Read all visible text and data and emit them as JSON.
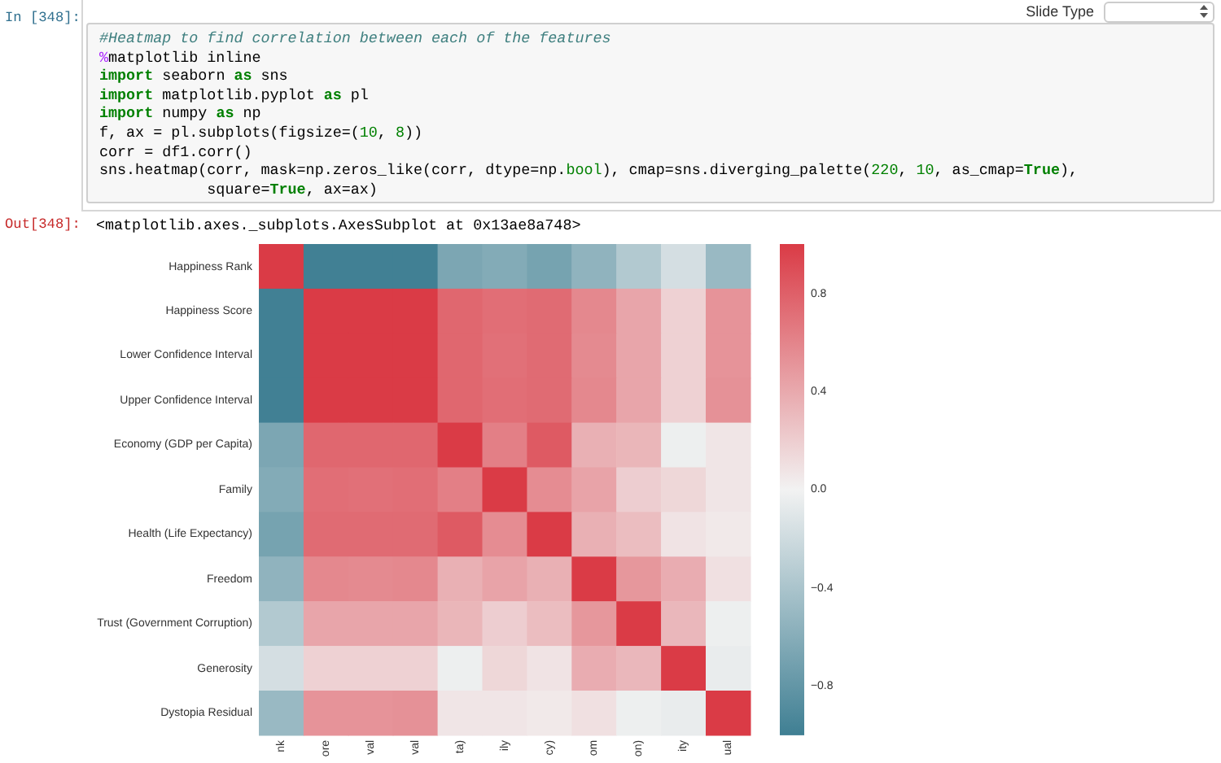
{
  "cell": {
    "prompt": "In [348]:",
    "toolbar": {
      "label": "Slide Type"
    },
    "code_lines": [
      [
        {
          "kind": "comment",
          "text": "#Heatmap to find correlation between each of the features"
        }
      ],
      [
        {
          "kind": "magic",
          "text": "%"
        },
        {
          "kind": "plain",
          "text": "matplotlib inline"
        }
      ],
      [
        {
          "kind": "keyword",
          "text": "import"
        },
        {
          "kind": "plain",
          "text": " seaborn "
        },
        {
          "kind": "keyword",
          "text": "as"
        },
        {
          "kind": "plain",
          "text": " sns"
        }
      ],
      [
        {
          "kind": "keyword",
          "text": "import"
        },
        {
          "kind": "plain",
          "text": " matplotlib.pyplot "
        },
        {
          "kind": "keyword",
          "text": "as"
        },
        {
          "kind": "plain",
          "text": " pl"
        }
      ],
      [
        {
          "kind": "keyword",
          "text": "import"
        },
        {
          "kind": "plain",
          "text": " numpy "
        },
        {
          "kind": "keyword",
          "text": "as"
        },
        {
          "kind": "plain",
          "text": " np"
        }
      ],
      [
        {
          "kind": "plain",
          "text": "f, ax = pl.subplots(figsize=("
        },
        {
          "kind": "number",
          "text": "10"
        },
        {
          "kind": "plain",
          "text": ", "
        },
        {
          "kind": "number",
          "text": "8"
        },
        {
          "kind": "plain",
          "text": "))"
        }
      ],
      [
        {
          "kind": "plain",
          "text": "corr = df1.corr()"
        }
      ],
      [
        {
          "kind": "plain",
          "text": "sns.heatmap(corr, mask=np.zeros_like(corr, dtype=np."
        },
        {
          "kind": "builtin",
          "text": "bool"
        },
        {
          "kind": "plain",
          "text": "), cmap=sns.diverging_palette("
        },
        {
          "kind": "number",
          "text": "220"
        },
        {
          "kind": "plain",
          "text": ", "
        },
        {
          "kind": "number",
          "text": "10"
        },
        {
          "kind": "plain",
          "text": ", as_cmap="
        },
        {
          "kind": "keyword",
          "text": "True"
        },
        {
          "kind": "plain",
          "text": "),"
        }
      ],
      [
        {
          "kind": "plain",
          "text": "            square="
        },
        {
          "kind": "keyword",
          "text": "True"
        },
        {
          "kind": "plain",
          "text": ", ax=ax)"
        }
      ]
    ]
  },
  "output": {
    "prompt": "Out[348]:",
    "text": "<matplotlib.axes._subplots.AxesSubplot at 0x13ae8a748>"
  },
  "heatmap": {
    "row_labels": [
      "Happiness Rank",
      "Happiness Score",
      "Lower Confidence Interval",
      "Upper Confidence Interval",
      "Economy (GDP per Capita)",
      "Family",
      "Health (Life Expectancy)",
      "Freedom",
      "Trust (Government Corruption)",
      "Generosity",
      "Dystopia Residual"
    ],
    "column_labels": [
      "nk",
      "ore",
      "val",
      "val",
      "ta)",
      "ily",
      "cy)",
      "om",
      "on)",
      "ity",
      "ual"
    ],
    "colorbar_ticks": [
      "0.8",
      "0.4",
      "0.0",
      "−0.4",
      "−0.8"
    ]
  }
}
